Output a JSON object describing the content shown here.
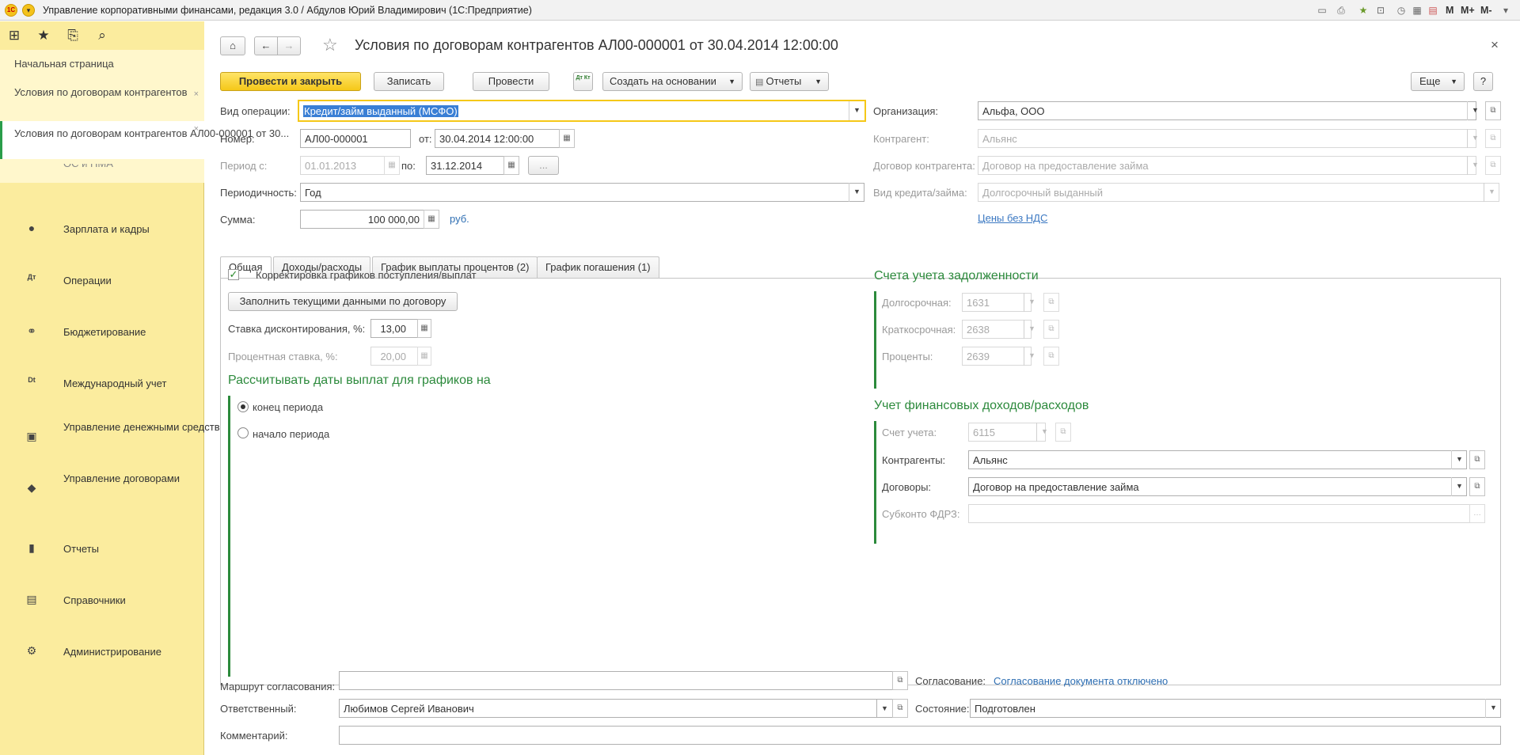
{
  "titlebar": {
    "logo": "1С",
    "title": "Управление корпоративными финансами, редакция 3.0 / Абдулов Юрий Владимирович (1С:Предприятие)",
    "memory_buttons": [
      "M",
      "M+",
      "M-"
    ]
  },
  "sidebar": {
    "open_tabs": [
      {
        "label": "Начальная страница"
      },
      {
        "label": "Условия по договорам контрагентов"
      },
      {
        "label": "Условия по договорам контрагентов АЛ00-000001 от 30..."
      }
    ],
    "partial_section": "ОС и НМА",
    "sections": [
      {
        "label": "Зарплата и кадры",
        "icon": "person-icon"
      },
      {
        "label": "Операции",
        "icon": "dt-kt-icon"
      },
      {
        "label": "Бюджетирование",
        "icon": "budget-icon"
      },
      {
        "label": "Международный учет",
        "icon": "intl-accounting-icon"
      },
      {
        "label": "Управление денежными средствами",
        "icon": "money-icon"
      },
      {
        "label": "Управление договорами",
        "icon": "handshake-icon"
      },
      {
        "label": "Отчеты",
        "icon": "bar-chart-icon"
      },
      {
        "label": "Справочники",
        "icon": "books-icon"
      },
      {
        "label": "Администрирование",
        "icon": "gear-icon"
      }
    ]
  },
  "header": {
    "title": "Условия по договорам контрагентов АЛ00-000001 от 30.04.2014 12:00:00"
  },
  "toolbar": {
    "post_close": "Провести и закрыть",
    "save": "Записать",
    "post": "Провести",
    "dtkt": "Дт Кт",
    "create_based": "Создать на основании",
    "reports": "Отчеты",
    "more": "Еще",
    "help": "?"
  },
  "form": {
    "op_type_label": "Вид операции:",
    "op_type_value": "Кредит/займ выданный (МСФО)",
    "number_label": "Номер:",
    "number_value": "АЛ00-000001",
    "from_label": "от:",
    "from_value": "30.04.2014 12:00:00",
    "period_label": "Период с:",
    "period_from": "01.01.2013",
    "period_to_label": "по:",
    "period_to": "31.12.2014",
    "ellipsis": "...",
    "periodicity_label": "Периодичность:",
    "periodicity_value": "Год",
    "sum_label": "Сумма:",
    "sum_value": "100 000,00",
    "currency": "руб.",
    "org_label": "Организация:",
    "org_value": "Альфа, ООО",
    "counterparty_label": "Контрагент:",
    "counterparty_value": "Альянс",
    "contract_label": "Договор контрагента:",
    "contract_value": "Договор на предоставление займа",
    "credit_type_label": "Вид кредита/займа:",
    "credit_type_value": "Долгосрочный выданный",
    "prices_link": "Цены без НДС"
  },
  "tabs": [
    {
      "label": "Общая"
    },
    {
      "label": "Доходы/расходы"
    },
    {
      "label": "График выплаты процентов (2)"
    },
    {
      "label": "График погашения (1)"
    }
  ],
  "general": {
    "adjust_label": "Корректировка графиков поступления/выплат",
    "adjust_checked": true,
    "fill_button": "Заполнить текущими данными по договору",
    "discount_label": "Ставка дисконтирования, %:",
    "discount_value": "13,00",
    "interest_label": "Процентная ставка, %:",
    "interest_value": "20,00",
    "dates_heading": "Рассчитывать даты выплат для графиков на",
    "radio_end": "конец периода",
    "radio_start": "начало периода",
    "radio_selected": "конец периода",
    "debt_heading": "Счета учета задолженности",
    "long_term_label": "Долгосрочная:",
    "long_term_value": "1631",
    "short_term_label": "Краткосрочная:",
    "short_term_value": "2638",
    "percent_label": "Проценты:",
    "percent_value": "2639",
    "fin_heading": "Учет финансовых доходов/расходов",
    "account_label": "Счет учета:",
    "account_value": "6115",
    "counterparties_label": "Контрагенты:",
    "counterparties_value": "Альянс",
    "contracts_label": "Договоры:",
    "contracts_value": "Договор на предоставление займа",
    "subconto_label": "Субконто ФДРЗ:",
    "subconto_value": ""
  },
  "footer": {
    "route_label": "Маршрут согласования:",
    "route_value": "",
    "approval_label": "Согласование:",
    "approval_link": "Согласование документа отключено",
    "responsible_label": "Ответственный:",
    "responsible_value": "Любимов Сергей Иванович",
    "state_label": "Состояние:",
    "state_value": "Подготовлен",
    "comment_label": "Комментарий:",
    "comment_value": ""
  },
  "colors": {
    "sidebar_bg": "#fbec9e",
    "accent_yellow": "#f5c818",
    "group_green": "#2c8a3c",
    "link_blue": "#2f6fb3"
  }
}
